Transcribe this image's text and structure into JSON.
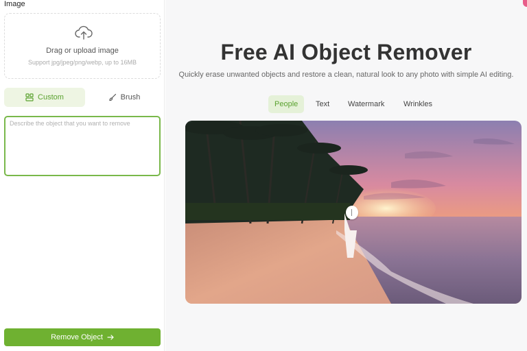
{
  "sidebar": {
    "section_label": "Image",
    "upload": {
      "title": "Drag or upload image",
      "subtitle": "Support jpg/jpeg/png/webp, up to 16MB",
      "icon": "cloud-upload-icon"
    },
    "modes": [
      {
        "label": "Custom",
        "icon": "layout-grid-icon",
        "active": true
      },
      {
        "label": "Brush",
        "icon": "brush-icon",
        "active": false
      }
    ],
    "prompt": {
      "placeholder": "Describe the object that you want to remove",
      "value": ""
    },
    "action": {
      "label": "Remove Object",
      "icon": "arrow-right-icon"
    }
  },
  "main": {
    "title": "Free AI Object Remover",
    "subtitle": "Quickly erase unwanted objects and restore a clean, natural look to any photo with simple AI editing.",
    "tabs": [
      {
        "label": "People",
        "active": true
      },
      {
        "label": "Text",
        "active": false
      },
      {
        "label": "Watermark",
        "active": false
      },
      {
        "label": "Wrinkles",
        "active": false
      }
    ]
  },
  "colors": {
    "accent": "#6fb131",
    "accent_light": "#eef5e3",
    "accent_text": "#5aa22f",
    "border_focus": "#79b84a"
  }
}
